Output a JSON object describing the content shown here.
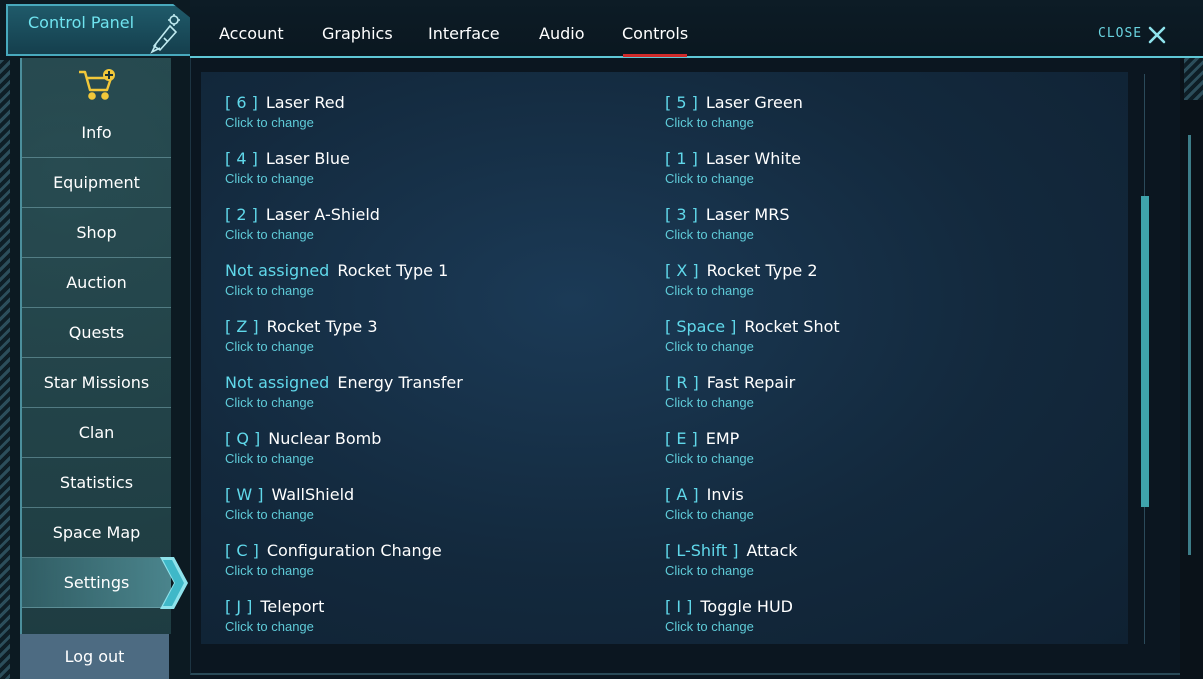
{
  "window": {
    "title": "Control Panel",
    "close_label": "CLOSE"
  },
  "tabs": [
    "Account",
    "Graphics",
    "Interface",
    "Audio",
    "Controls"
  ],
  "active_tab": "Controls",
  "sidebar": {
    "items": [
      "Info",
      "Equipment",
      "Shop",
      "Auction",
      "Quests",
      "Star Missions",
      "Clan",
      "Statistics",
      "Space Map",
      "Settings"
    ],
    "active": "Settings",
    "logout": "Log out"
  },
  "bindings": [
    {
      "key": "[ 6 ]",
      "action": "Laser Red",
      "hint": "Click to change"
    },
    {
      "key": "[ 5 ]",
      "action": "Laser Green",
      "hint": "Click to change"
    },
    {
      "key": "[ 4 ]",
      "action": "Laser Blue",
      "hint": "Click to change"
    },
    {
      "key": "[ 1 ]",
      "action": "Laser White",
      "hint": "Click to change"
    },
    {
      "key": "[ 2 ]",
      "action": "Laser A-Shield",
      "hint": "Click to change"
    },
    {
      "key": "[ 3 ]",
      "action": "Laser MRS",
      "hint": "Click to change"
    },
    {
      "key": "Not assigned",
      "action": "Rocket Type 1",
      "hint": "Click to change"
    },
    {
      "key": "[ X ]",
      "action": "Rocket Type 2",
      "hint": "Click to change"
    },
    {
      "key": "[ Z ]",
      "action": "Rocket Type 3",
      "hint": "Click to change"
    },
    {
      "key": "[ Space ]",
      "action": "Rocket Shot",
      "hint": "Click to change"
    },
    {
      "key": "Not assigned",
      "action": "Energy Transfer",
      "hint": "Click to change"
    },
    {
      "key": "[ R ]",
      "action": "Fast Repair",
      "hint": "Click to change"
    },
    {
      "key": "[ Q ]",
      "action": "Nuclear Bomb",
      "hint": "Click to change"
    },
    {
      "key": "[ E ]",
      "action": "EMP",
      "hint": "Click to change"
    },
    {
      "key": "[ W ]",
      "action": "WallShield",
      "hint": "Click to change"
    },
    {
      "key": "[ A ]",
      "action": "Invis",
      "hint": "Click to change"
    },
    {
      "key": "[ C ]",
      "action": "Configuration Change",
      "hint": "Click to change"
    },
    {
      "key": "[ L-Shift ]",
      "action": "Attack",
      "hint": "Click to change"
    },
    {
      "key": "[ J ]",
      "action": "Teleport",
      "hint": "Click to change"
    },
    {
      "key": "[ I ]",
      "action": "Toggle HUD",
      "hint": "Click to change"
    }
  ],
  "colors": {
    "accent": "#60d8ea",
    "tab_underline": "#d02a2a",
    "logout_bg": "#4d6b82"
  },
  "icons": [
    "shuttle-icon",
    "cart-icon",
    "close-icon",
    "chevron-right-icon"
  ]
}
